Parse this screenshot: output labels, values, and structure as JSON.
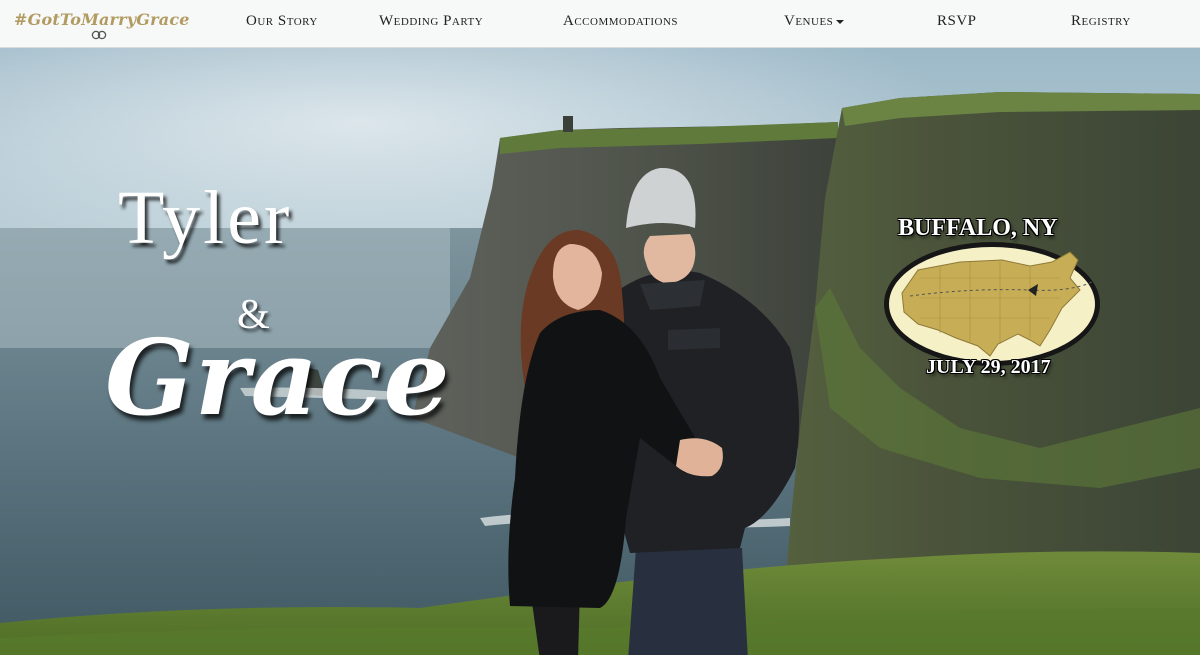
{
  "brand": {
    "text": "#GotToMarryGrace"
  },
  "nav": {
    "items": [
      {
        "label": "Our Story"
      },
      {
        "label": "Wedding Party"
      },
      {
        "label": "Accommodations"
      },
      {
        "label": "Venues"
      },
      {
        "label": "RSVP"
      },
      {
        "label": "Registry"
      }
    ]
  },
  "hero": {
    "name_first": "Tyler",
    "ampersand": "&",
    "name_second": "Grace",
    "location": "BUFFALO, NY",
    "date": "JULY 29, 2017"
  },
  "colors": {
    "brand_gold": "#b29b61",
    "map_gold": "#c7ad55",
    "nav_bg": "#f7f8f8"
  },
  "icons": {
    "rings": "wedding-rings-icon",
    "dropdown": "caret-down-icon"
  }
}
